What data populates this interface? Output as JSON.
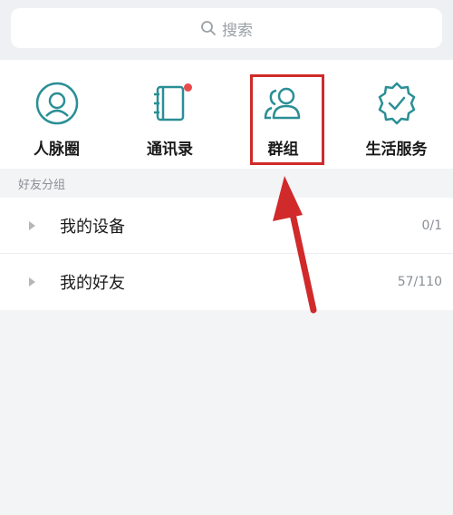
{
  "search": {
    "placeholder": "搜索"
  },
  "shortcuts": [
    {
      "label": "人脉圈",
      "icon": "contacts-circle-icon"
    },
    {
      "label": "通讯录",
      "icon": "address-book-icon",
      "has_badge": true
    },
    {
      "label": "群组",
      "icon": "group-icon",
      "highlighted": true
    },
    {
      "label": "生活服务",
      "icon": "life-service-icon"
    }
  ],
  "section": {
    "title": "好友分组"
  },
  "groups": [
    {
      "name": "我的设备",
      "count": "0/1"
    },
    {
      "name": "我的好友",
      "count": "57/110"
    }
  ],
  "colors": {
    "accent": "#2a8f95",
    "badge": "#e94b4b",
    "annotation": "#d02a2a"
  }
}
